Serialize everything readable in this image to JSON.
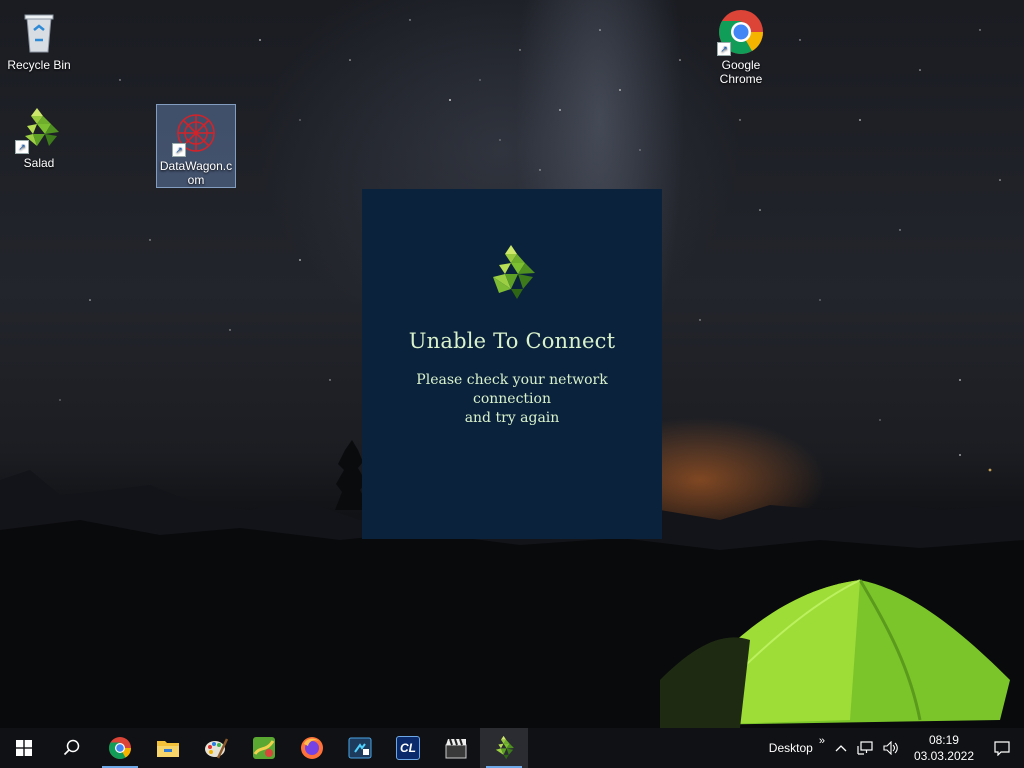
{
  "desktop": {
    "icons": [
      {
        "label": "Recycle Bin"
      },
      {
        "label": "Salad"
      },
      {
        "label": "DataWagon.c om"
      },
      {
        "label": "Google Chrome"
      }
    ]
  },
  "dialog": {
    "title": "Unable To Connect",
    "message_line1": "Please check your network connection",
    "message_line2": "and try again"
  },
  "taskbar": {
    "apps": [
      "start-icon",
      "search-icon",
      "chrome-icon",
      "file-explorer-icon",
      "paint-icon",
      "maps-icon",
      "firefox-icon",
      "video-editor-icon",
      "cl-icon",
      "clapperboard-icon",
      "salad-icon"
    ],
    "cl_text": "CL",
    "tray": {
      "desktop_label": "Desktop",
      "toolbar_expand": "»",
      "time": "08:19",
      "date": "03.03.2022"
    }
  },
  "colors": {
    "dialog_bg": "#0a223b",
    "dialog_text": "#d9f2cc",
    "salad_green": "#8bc34a",
    "taskbar_bg": "#101114"
  }
}
